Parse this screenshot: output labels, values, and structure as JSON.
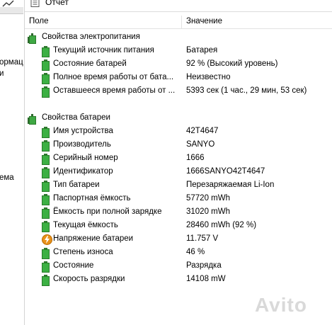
{
  "left_panel": {
    "fragments": [
      "ормац",
      "и",
      "ема"
    ]
  },
  "toolbar": {
    "report_label": "Отчет"
  },
  "columns": {
    "field": "Поле",
    "value": "Значение"
  },
  "groups": [
    {
      "title": "Свойства электропитания",
      "rows": [
        {
          "name": "Текущий источник питания",
          "value": "Батарея",
          "icon": "battery-icon"
        },
        {
          "name": "Состояние батарей",
          "value": "92 % (Высокий уровень)",
          "icon": "battery-icon"
        },
        {
          "name": "Полное время работы от бата...",
          "value": "Неизвестно",
          "icon": "battery-icon"
        },
        {
          "name": "Оставшееся время работы от ...",
          "value": "5393 сек (1 час., 29 мин, 53 сек)",
          "icon": "battery-icon"
        }
      ]
    },
    {
      "title": "Свойства батареи",
      "rows": [
        {
          "name": "Имя устройства",
          "value": "42T4647",
          "icon": "battery-icon"
        },
        {
          "name": "Производитель",
          "value": "SANYO",
          "icon": "battery-icon"
        },
        {
          "name": "Серийный номер",
          "value": "1666",
          "icon": "battery-icon"
        },
        {
          "name": "Идентификатор",
          "value": "1666SANYO42T4647",
          "icon": "battery-icon"
        },
        {
          "name": "Тип батареи",
          "value": "Перезаряжаемая Li-Ion",
          "icon": "battery-icon"
        },
        {
          "name": "Паспортная ёмкость",
          "value": "57720 mWh",
          "icon": "battery-icon"
        },
        {
          "name": "Ёмкость при полной зарядке",
          "value": "31020 mWh",
          "icon": "battery-icon"
        },
        {
          "name": "Текущая ёмкость",
          "value": "28460 mWh  (92 %)",
          "icon": "battery-icon"
        },
        {
          "name": "Напряжение батареи",
          "value": "11.757 V",
          "icon": "voltage-icon"
        },
        {
          "name": "Степень износа",
          "value": "46 %",
          "icon": "battery-icon"
        },
        {
          "name": "Состояние",
          "value": "Разрядка",
          "icon": "battery-icon"
        },
        {
          "name": "Скорость разрядки",
          "value": "14108 mW",
          "icon": "battery-icon"
        }
      ]
    }
  ],
  "watermark": "Avito"
}
